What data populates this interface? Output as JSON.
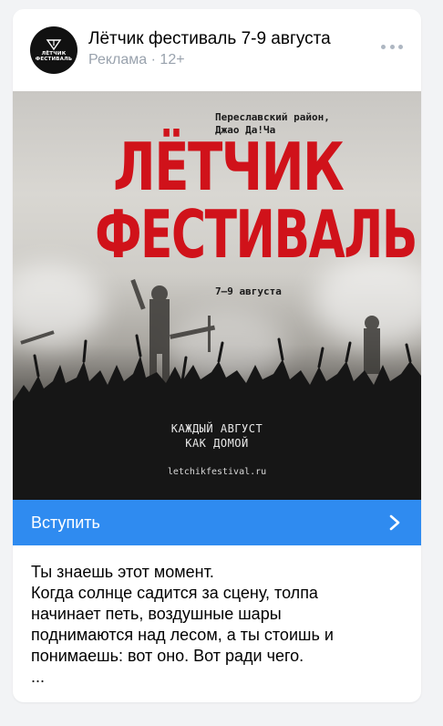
{
  "post": {
    "title": "Лётчик фестиваль 7-9 августа",
    "ad_label": "Реклама",
    "separator": "·",
    "age_rating": "12+",
    "avatar_text_line1": "ЛЁТЧИК",
    "avatar_text_line2": "ФЕСТИВАЛЬ",
    "more_icon": "more-horizontal-icon"
  },
  "poster": {
    "location_line1": "Переславский район,",
    "location_line2": "Джао Да!Ча",
    "headline_line1": "ЛЁТЧИК",
    "headline_line2": "ФЕСТИВАЛЬ",
    "dates": "7–9 августа",
    "slogan_line1": "КАЖДЫЙ АВГУСТ",
    "slogan_line2": "КАК ДОМОЙ",
    "website": "letchikfestival.ru",
    "headline_color": "#d0121a"
  },
  "cta": {
    "label": "Вступить",
    "color": "#2f8bf0",
    "icon": "chevron-right-icon"
  },
  "text": {
    "line1": "Ты знаешь этот момент.",
    "line2": "Когда солнце садится за сцену, толпа",
    "line3": "начинает петь, воздушные шары",
    "line4": "поднимаются над лесом, а ты стоишь и",
    "line5": "понимаешь: вот оно. Вот ради чего.",
    "line6": "..."
  }
}
